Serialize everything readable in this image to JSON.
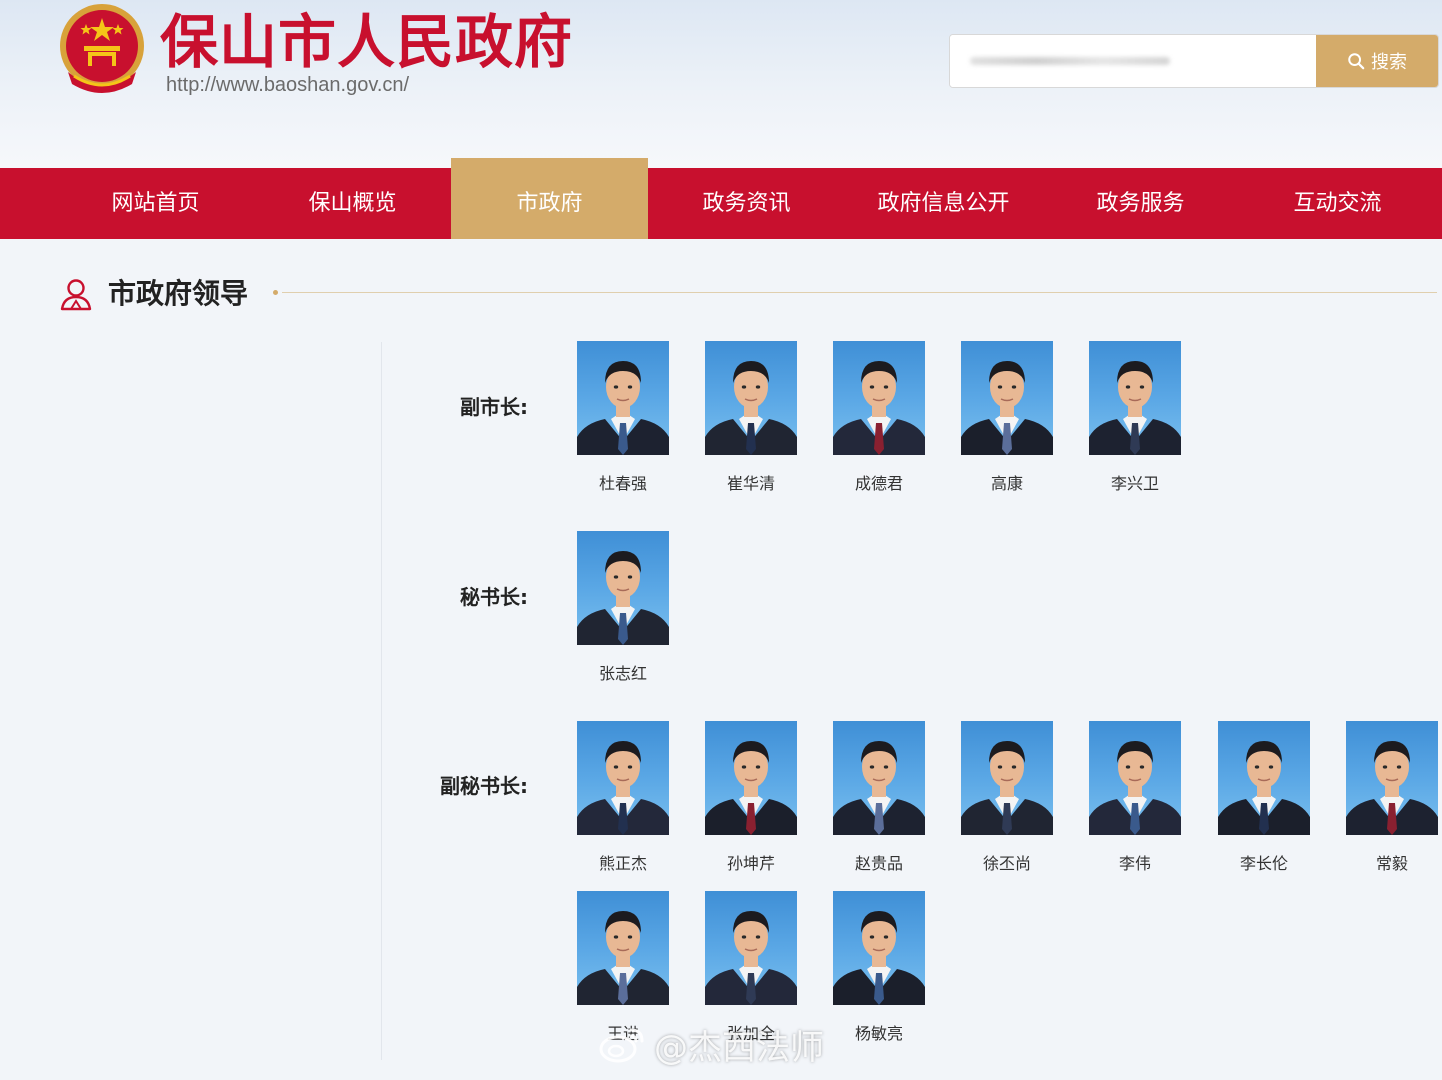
{
  "site": {
    "title": "保山市人民政府",
    "url": "http://www.baoshan.gov.cn/"
  },
  "search": {
    "button_label": "搜索",
    "placeholder": ""
  },
  "nav": {
    "items": [
      {
        "label": "网站首页",
        "active": false
      },
      {
        "label": "保山概览",
        "active": false
      },
      {
        "label": "市政府",
        "active": true
      },
      {
        "label": "政务资讯",
        "active": false
      },
      {
        "label": "政府信息公开",
        "active": false
      },
      {
        "label": "政务服务",
        "active": false
      },
      {
        "label": "互动交流",
        "active": false
      }
    ]
  },
  "section": {
    "title": "市政府领导"
  },
  "groups": [
    {
      "label": "副市长:",
      "people": [
        "杜春强",
        "崔华清",
        "成德君",
        "高康",
        "李兴卫"
      ]
    },
    {
      "label": "秘书长:",
      "people": [
        "张志红"
      ]
    },
    {
      "label": "副秘书长:",
      "people": [
        "熊正杰",
        "孙坤芹",
        "赵贵品",
        "徐丕尚",
        "李伟",
        "李长伦",
        "常毅",
        "王进",
        "张加全",
        "杨敏亮"
      ]
    }
  ],
  "watermark": {
    "text": "@杰西法师"
  },
  "colors": {
    "brand_red": "#c8102e",
    "accent_gold": "#d4ab6a",
    "photo_bg": "#4a9ae0"
  }
}
